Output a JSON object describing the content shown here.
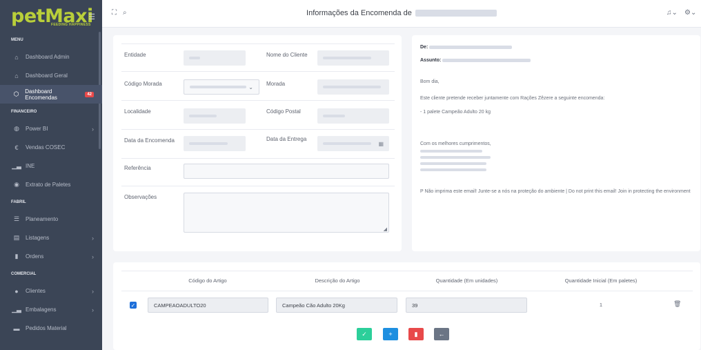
{
  "sidebar": {
    "logo": "petMaxi",
    "logo_tagline": "FEEDING HAPPINESS",
    "sections": {
      "menu": "MENU",
      "financeiro": "FINANCEIRO",
      "fabril": "FABRIL",
      "comercial": "COMERCIAL"
    },
    "items": {
      "dashboard_admin": "Dashboard Admin",
      "dashboard_geral": "Dashboard Geral",
      "dashboard_encomendas": "Dashboard Encomendas",
      "dashboard_encomendas_badge": "42",
      "power_bi": "Power BI",
      "vendas_cosec": "Vendas COSEC",
      "ine": "INE",
      "extrato_paletes": "Extrato de Paletes",
      "planeamento": "Planeamento",
      "listagens": "Listagens",
      "ordens": "Ordens",
      "clientes": "Clientes",
      "embalagens": "Embalagens",
      "pedidos_material": "Pedidos Material"
    }
  },
  "topbar": {
    "title": "Informações da Encomenda de"
  },
  "form": {
    "entidade_label": "Entidade",
    "nome_cliente_label": "Nome do Cliente",
    "codigo_morada_label": "Código Morada",
    "morada_label": "Morada",
    "localidade_label": "Localidade",
    "codigo_postal_label": "Código Postal",
    "data_encomenda_label": "Data da Encomenda",
    "data_entrega_label": "Data da Entrega",
    "referencia_label": "Referência",
    "observacoes_label": "Observações"
  },
  "email": {
    "de_label": "De:",
    "assunto_label": "Assunto:",
    "greeting": "Bom dia,",
    "body1": "Este cliente pretende receber juntamente com Rações Zêzere a seguinte encomenda:",
    "body2": "- 1 palete Campeão Adulto 20 kg",
    "closing": "Com os melhores cumprimentos,",
    "footer": "P Não imprima este email! Junte-se a nós na proteção do ambiente | Do not print this email! Join in protecting the environment"
  },
  "table": {
    "headers": [
      "Código do Artigo",
      "Descrição do Artigo",
      "Quantidade (Em unidades)",
      "Quantidade Inicial (Em paletes)"
    ],
    "rows": [
      {
        "codigo": "CAMPEAOADULTO20",
        "descricao": "Campeão Cão Adulto 20Kg",
        "quantidade": "39",
        "paletes": "1"
      }
    ]
  },
  "colors": {
    "sidebar": "#3b4556",
    "logo": "#b9cf3a",
    "badge": "#e8494a",
    "confirm": "#2ccf9a",
    "add": "#1e8fe0",
    "delete": "#e8494a",
    "back": "#6b7585"
  },
  "icons": [
    "menu-toggle-icon",
    "expand-icon",
    "search-icon",
    "bell-icon",
    "gear-icon",
    "home-icon",
    "cube-icon",
    "chart-icon",
    "euro-icon",
    "eye-icon",
    "list-icon",
    "user-icon",
    "truck-icon",
    "trash-icon",
    "check-icon",
    "plus-icon",
    "arrow-left-icon"
  ]
}
